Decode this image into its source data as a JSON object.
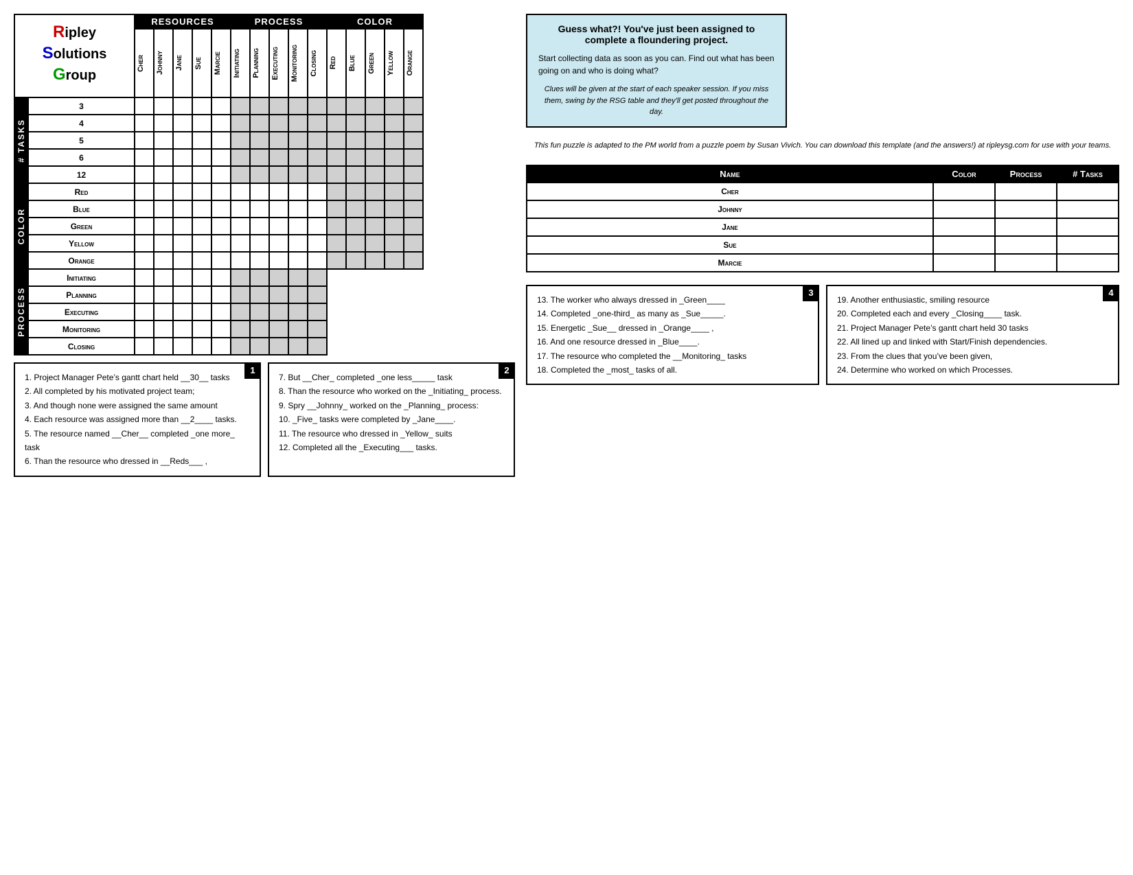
{
  "logo": {
    "line1": "ipley",
    "line2": "olutions",
    "line3": "roup"
  },
  "headers": {
    "resources": "Resources",
    "process": "Process",
    "color": "Color"
  },
  "columns": {
    "resources": [
      "Cher",
      "Johnny",
      "Jane",
      "Sue",
      "Marcie"
    ],
    "process": [
      "Initiating",
      "Planning",
      "Executing",
      "Monitoring",
      "Closing"
    ],
    "color": [
      "Red",
      "Blue",
      "Green",
      "Yellow",
      "Orange"
    ]
  },
  "row_groups": {
    "tasks": {
      "label": "# Tasks",
      "rows": [
        "3",
        "4",
        "5",
        "6",
        "12"
      ]
    },
    "color": {
      "label": "Color",
      "rows": [
        "Red",
        "Blue",
        "Green",
        "Yellow",
        "Orange"
      ]
    },
    "process": {
      "label": "Process",
      "rows": [
        "Initiating",
        "Planning",
        "Executing",
        "Monitoring",
        "Closing"
      ]
    }
  },
  "info_panel": {
    "title": "Guess what?! You've just been assigned to complete a floundering project.",
    "body1": "Start collecting data as soon as you can.  Find out what has been going on and who is doing what?",
    "clue_note": "Clues will be given at the start of each speaker session.  If you miss them, swing by the RSG table and they'll get posted throughout the day.",
    "puzzle_note": "This fun puzzle is adapted to the PM world from a puzzle poem by Susan Vivich.  You can download this template (and the answers!) at ripleysg.com for use with your teams."
  },
  "answer_table": {
    "headers": [
      "Name",
      "Color",
      "Process",
      "# Tasks"
    ],
    "rows": [
      {
        "name": "Cher"
      },
      {
        "name": "Johnny"
      },
      {
        "name": "Jane"
      },
      {
        "name": "Sue"
      },
      {
        "name": "Marcie"
      }
    ]
  },
  "clues": {
    "box1": [
      "1.  Project Manager Pete’s gantt chart held __30__ tasks",
      "2.  All completed by his motivated project team;",
      "3.  And though none were assigned the same amount",
      "4.  Each resource was assigned more than __2____ tasks.",
      "5.  The resource named __Cher__ completed _one more_ task",
      "6.  Than the resource who dressed in __Reds___ ,"
    ],
    "box2": [
      "7.  But __Cher_ completed _one less_____ task",
      "8.  Than the resource who worked on the _Initiating_ process.",
      "9.  Spry __Johnny_ worked on the _Planning_ process:",
      "10. _Five_ tasks were completed by _Jane____.",
      "11. The resource who dressed in _Yellow_ suits",
      "12. Completed all the _Executing___ tasks."
    ],
    "box3": [
      "13. The worker who always dressed in _Green____",
      "14. Completed _one-third_ as many as _Sue_____.",
      "15. Energetic _Sue__ dressed in _Orange____ ,",
      "16. And one resource dressed in _Blue____.",
      "17. The resource who completed the __Monitoring_ tasks",
      "18. Completed the _most_ tasks of all."
    ],
    "box4": [
      "19. Another enthusiastic, smiling resource",
      "20. Completed each and every _Closing____ task.",
      "21. Project Manager Pete’s gantt chart held 30 tasks",
      "22. All lined up and linked with Start/Finish dependencies.",
      "23. From the clues that you’ve been given,",
      "24. Determine who worked on which Processes."
    ]
  }
}
